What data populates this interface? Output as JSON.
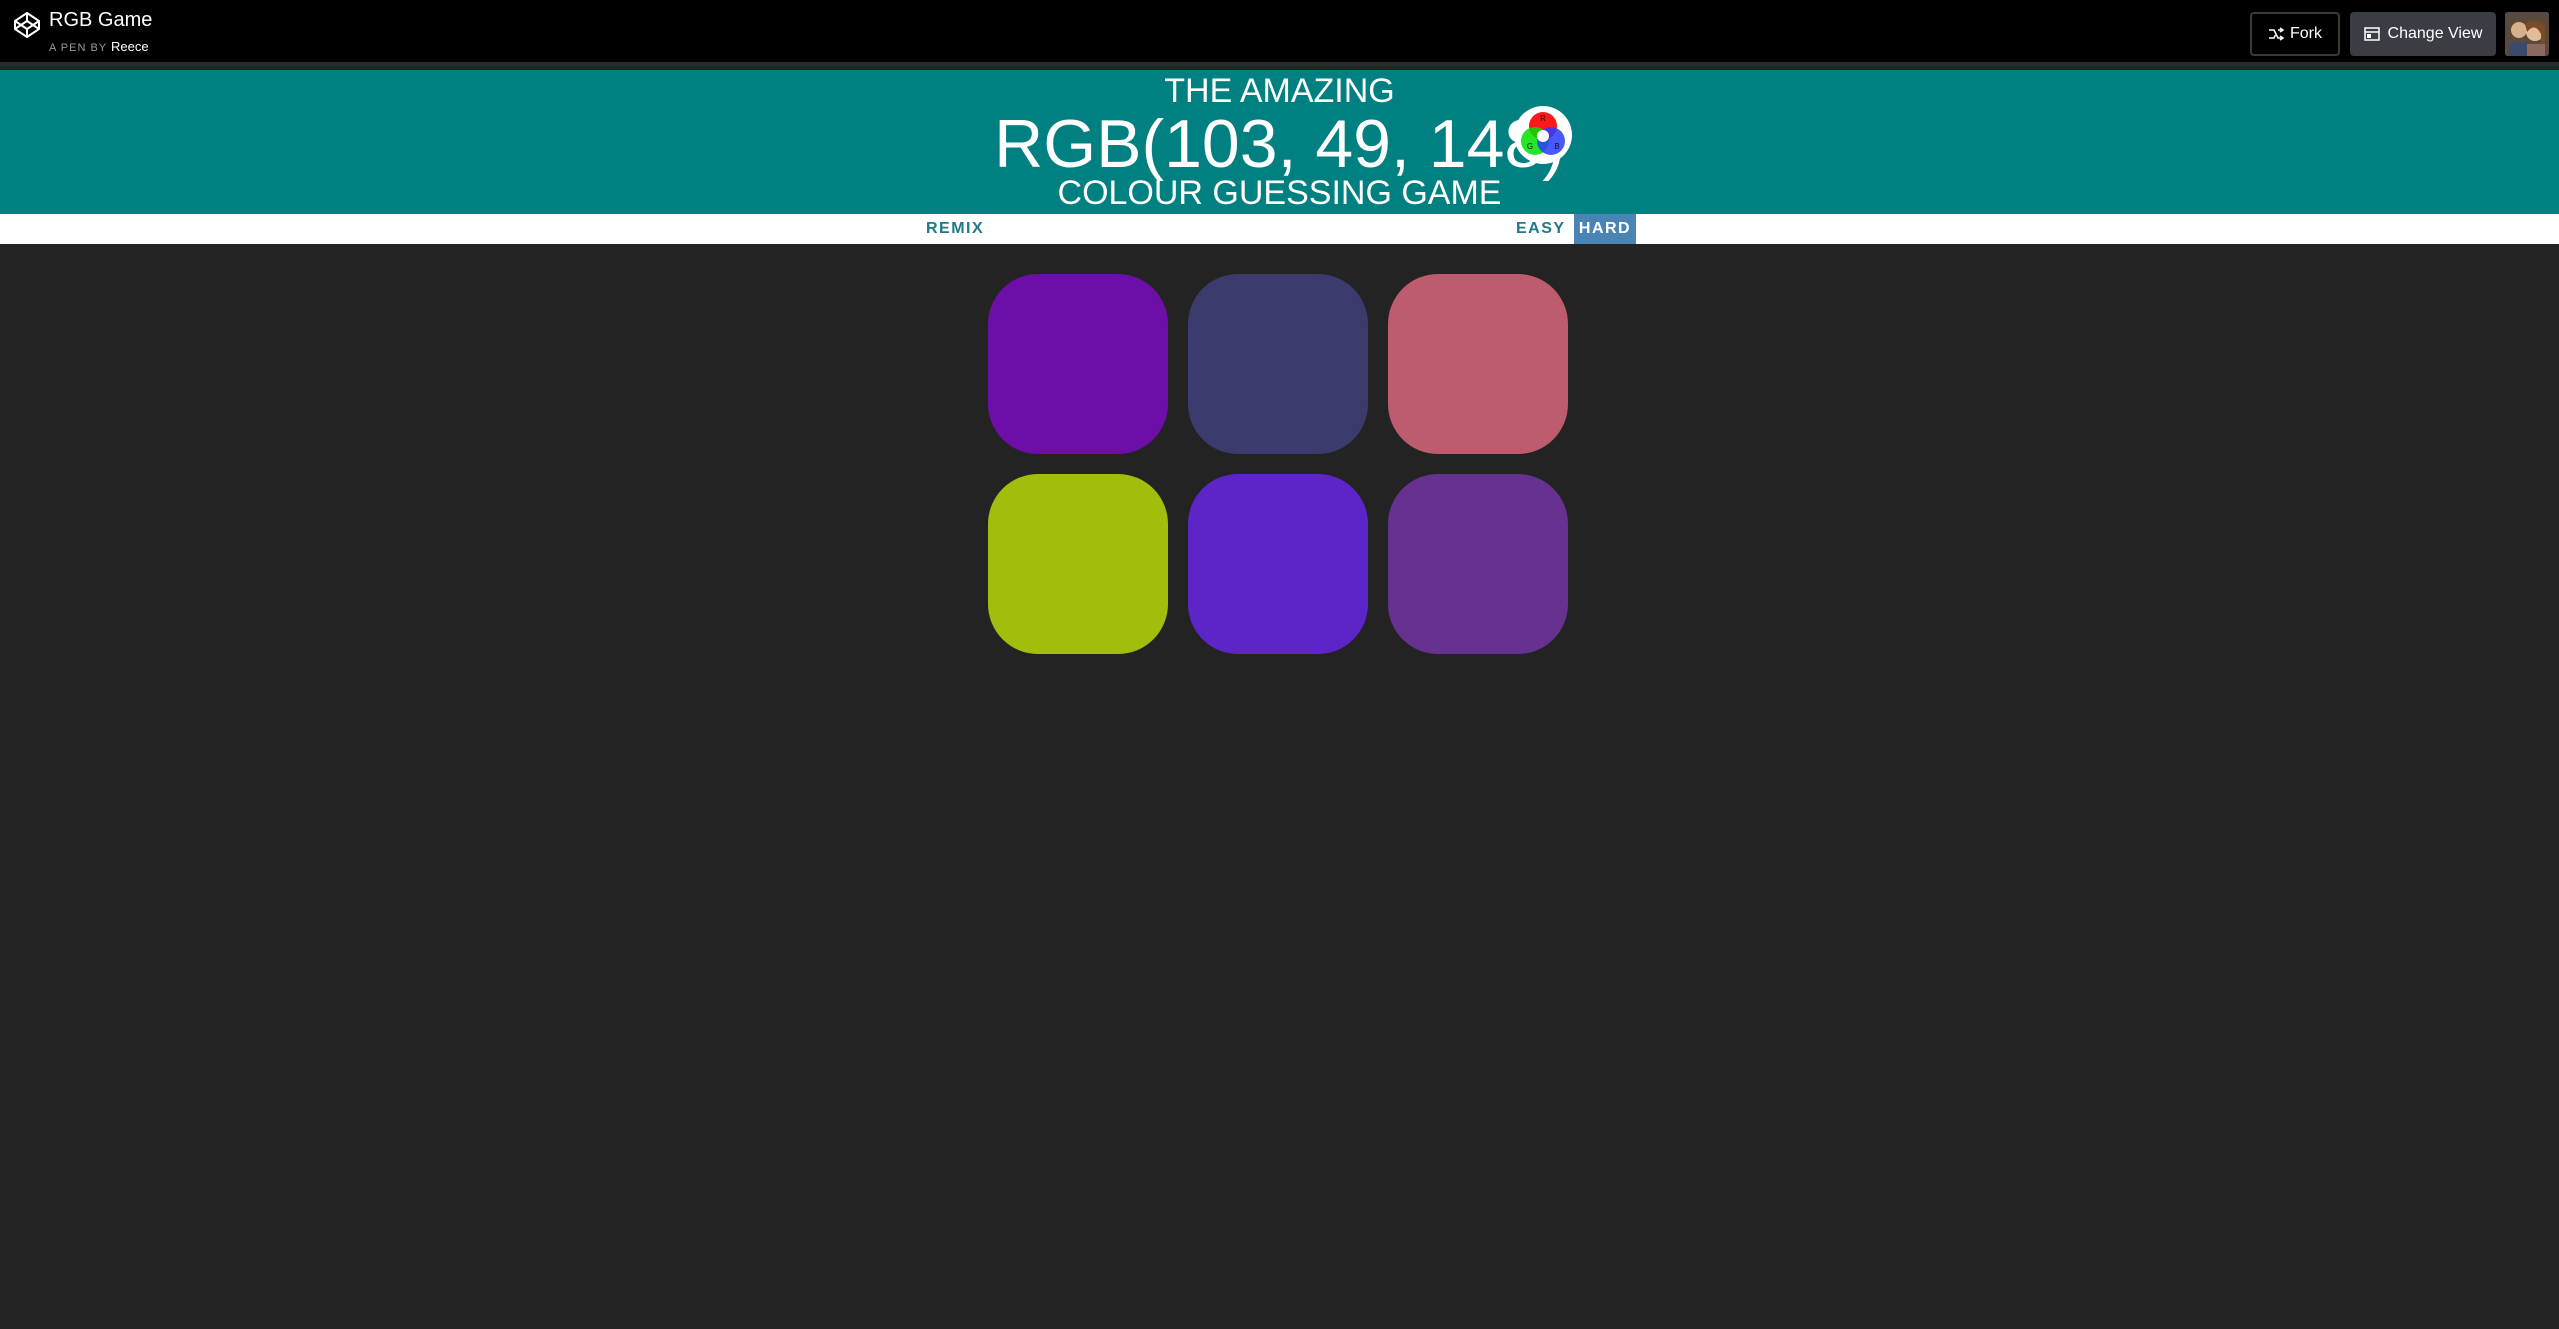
{
  "codepen": {
    "title": "RGB Game",
    "by_prefix": "A PEN BY",
    "author": "Reece",
    "fork_label": "Fork",
    "change_view_label": "Change View"
  },
  "header": {
    "line1": "THE AMAZING",
    "rgb": "RGB(103, 49, 148)",
    "line3": "COLOUR GUESSING GAME",
    "logo_letters": {
      "r": "R",
      "g": "G",
      "b": "B"
    }
  },
  "menu": {
    "remix": "REMIX",
    "easy": "EASY",
    "hard": "HARD",
    "selected_mode": "HARD"
  },
  "colors": {
    "header_bg": "#008080",
    "page_bg": "#232323",
    "selected_mode_bg": "#4a84b4"
  },
  "squares": [
    {
      "color": "#6e0ea8"
    },
    {
      "color": "#3b3b6e"
    },
    {
      "color": "#bd5c6e"
    },
    {
      "color": "#a3bd0c"
    },
    {
      "color": "#5d25c8"
    },
    {
      "color": "#67318f"
    }
  ]
}
